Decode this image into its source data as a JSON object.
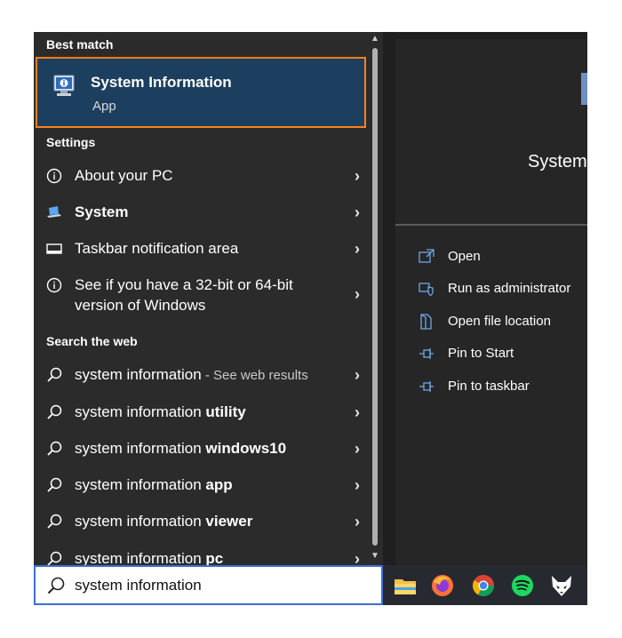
{
  "sections": {
    "best_match": "Best match",
    "settings": "Settings",
    "search_web": "Search the web"
  },
  "best_match": {
    "name": "System Information",
    "type": "App",
    "icon": "system-information-icon"
  },
  "settings": [
    {
      "label": "About your PC",
      "icon": "info-icon"
    },
    {
      "label": "System",
      "icon": "laptop-icon"
    },
    {
      "label": "Taskbar notification area",
      "icon": "taskbar-icon"
    },
    {
      "label": "See if you have a 32-bit or 64-bit",
      "label2": "version of Windows",
      "icon": "info-icon"
    }
  ],
  "web": [
    {
      "prefix": "system information",
      "bold": "",
      "hint": " - See web results"
    },
    {
      "prefix": "system information ",
      "bold": "utility",
      "hint": ""
    },
    {
      "prefix": "system information ",
      "bold": "windows10",
      "hint": ""
    },
    {
      "prefix": "system information ",
      "bold": "app",
      "hint": ""
    },
    {
      "prefix": "system information ",
      "bold": "viewer",
      "hint": ""
    },
    {
      "prefix": "system information ",
      "bold": "pc",
      "hint": ""
    }
  ],
  "right_panel": {
    "title": "System",
    "actions": [
      {
        "label": "Open",
        "icon": "open-icon"
      },
      {
        "label": "Run as administrator",
        "icon": "shield-icon"
      },
      {
        "label": "Open file location",
        "icon": "file-location-icon"
      },
      {
        "label": "Pin to Start",
        "icon": "pin-icon"
      },
      {
        "label": "Pin to taskbar",
        "icon": "pin-icon"
      }
    ]
  },
  "search": {
    "value": "system information"
  },
  "taskbar": {
    "apps": [
      "file-explorer-icon",
      "firefox-icon",
      "chrome-icon",
      "spotify-icon",
      "fox-app-icon"
    ]
  },
  "colors": {
    "highlight": "#1c3f5f",
    "highlight_border": "#ff7f18",
    "search_border": "#3c6fd1",
    "action_icon": "#6ea8e8"
  }
}
